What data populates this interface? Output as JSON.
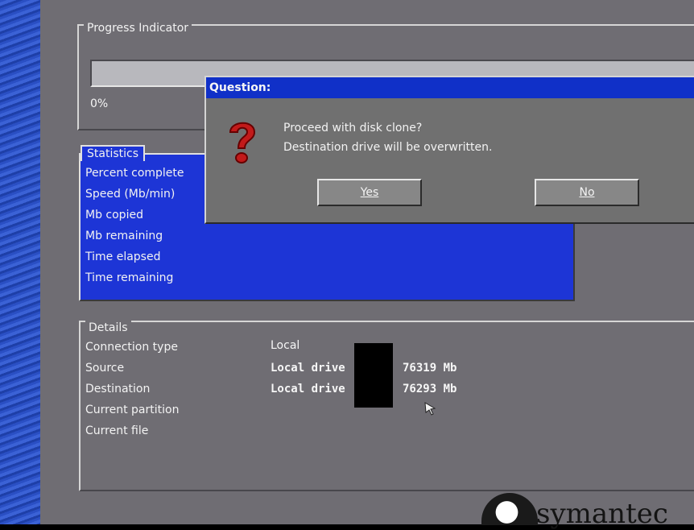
{
  "progress": {
    "legend": "Progress Indicator",
    "percent_text": "0%",
    "fraction": 0
  },
  "statistics": {
    "legend": "Statistics",
    "rows": [
      "Percent complete",
      "Speed (Mb/min)",
      "Mb copied",
      "Mb remaining",
      "Time elapsed",
      "Time remaining"
    ]
  },
  "details": {
    "legend": "Details",
    "labels": [
      "Connection type",
      "Source",
      "Destination",
      "Current partition",
      "Current file"
    ],
    "connection_value": "Local",
    "source_prefix": "Local drive",
    "source_size": "76319 Mb",
    "destination_prefix": "Local drive",
    "destination_size": "76293 Mb"
  },
  "dialog": {
    "title": "Question:",
    "line1": "Proceed with disk clone?",
    "line2": "Destination drive will be overwritten.",
    "yes_label": "Yes",
    "no_label": "No",
    "icon": "question-mark-icon"
  },
  "brand": {
    "name": "symantec"
  },
  "colors": {
    "stats_bg": "#1d35d6",
    "dialog_title_bg": "#1030c8",
    "screen_bg": "#6f6d73"
  }
}
